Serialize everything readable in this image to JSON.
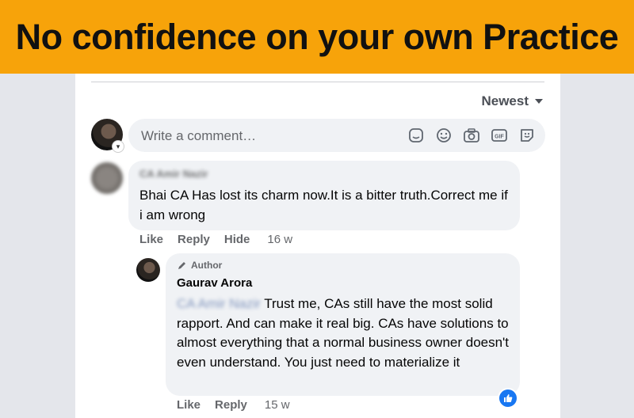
{
  "banner": {
    "title": "No confidence on your own Practice"
  },
  "sort": {
    "label": "Newest"
  },
  "composer": {
    "placeholder": "Write a comment…"
  },
  "comments": [
    {
      "author": "CA Amir Nazir",
      "text": "Bhai CA Has lost its charm now.It is a bitter truth.Correct me if i am wrong",
      "actions": {
        "like": "Like",
        "reply": "Reply",
        "hide": "Hide",
        "time": "16 w"
      }
    }
  ],
  "reply": {
    "author_tag": "Author",
    "author": "Gaurav Arora",
    "mention": "CA Amir Nazir",
    "text": " Trust me, CAs still have the most solid rapport. And can make it real big. CAs have solutions to almost everything that a normal business owner doesn't even understand. You just need to materialize it",
    "actions": {
      "like": "Like",
      "reply": "Reply",
      "time": "15 w"
    }
  },
  "colors": {
    "banner": "#f7a30a",
    "like_blue": "#1877f2"
  },
  "icons": [
    "chevron-down-icon",
    "sticker-icon",
    "emoji-icon",
    "camera-icon",
    "gif-icon",
    "avatar-sticker-icon",
    "pencil-icon",
    "thumbs-up-icon"
  ]
}
